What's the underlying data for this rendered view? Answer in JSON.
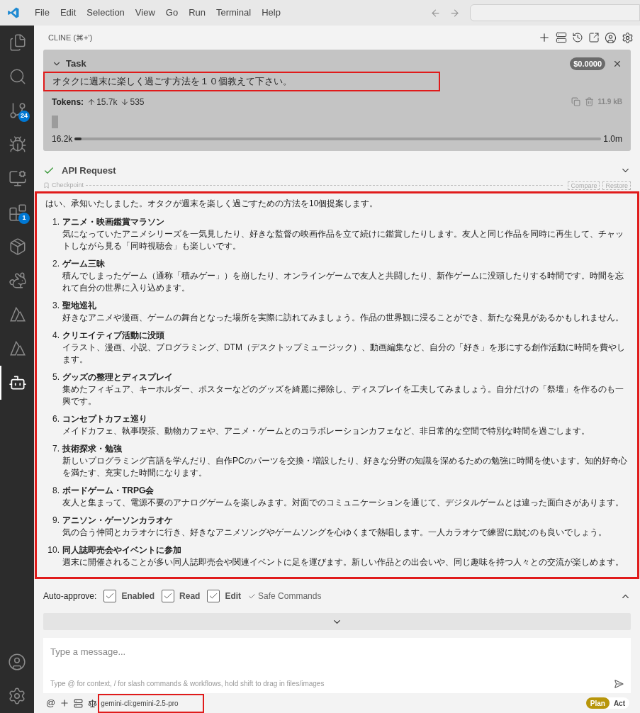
{
  "menu": [
    "File",
    "Edit",
    "Selection",
    "View",
    "Go",
    "Run",
    "Terminal",
    "Help"
  ],
  "activity_bar": [
    {
      "kind": "files",
      "selected": false
    },
    {
      "kind": "search",
      "selected": false
    },
    {
      "kind": "branch",
      "selected": false,
      "badge": "24"
    },
    {
      "kind": "debug",
      "selected": false
    },
    {
      "kind": "remote",
      "selected": false
    },
    {
      "kind": "blocks",
      "selected": false,
      "badge": "1"
    },
    {
      "kind": "package",
      "selected": false
    },
    {
      "kind": "animal",
      "selected": false
    },
    {
      "kind": "triangle",
      "selected": false
    },
    {
      "kind": "triangle",
      "selected": false
    },
    {
      "kind": "bot",
      "selected": true
    }
  ],
  "panel": {
    "title": "CLINE (⌘+')"
  },
  "task": {
    "title": "Task",
    "expanded": true,
    "cost": "$0.0000",
    "text": "オタクに週末に楽しく過ごす方法を１０個教えて下さい。",
    "highlighted": true,
    "tokens_label": "Tokens:",
    "tokens_in": "15.7k",
    "tokens_out": "535",
    "size": "11.9 kB",
    "context_used": "16.2k",
    "context_max": "1.0m",
    "level": 0.013
  },
  "api_request": {
    "title": "API Request",
    "done": true
  },
  "checkpoint": {
    "label": "Checkpoint",
    "buttons": [
      "Compare",
      "Restore"
    ]
  },
  "message": {
    "highlighted": true,
    "intro": "はい、承知いたしました。オタクが週末を楽しく過ごすための方法を10個提案します。",
    "items": [
      {
        "number": "1.",
        "title": "アニメ・映画鑑賞マラソン",
        "body": "気になっていたアニメシリーズを一気見したり、好きな監督の映画作品を立て続けに鑑賞したりします。友人と同じ作品を同時に再生して、チャットしながら見る「同時視聴会」も楽しいです。"
      },
      {
        "number": "2.",
        "title": "ゲーム三昧",
        "body": "積んでしまったゲーム（通称「積みゲー」）を崩したり、オンラインゲームで友人と共闘したり、新作ゲームに没頭したりする時間です。時間を忘れて自分の世界に入り込めます。"
      },
      {
        "number": "3.",
        "title": "聖地巡礼",
        "body": "好きなアニメや漫画、ゲームの舞台となった場所を実際に訪れてみましょう。作品の世界観に浸ることができ、新たな発見があるかもしれません。"
      },
      {
        "number": "4.",
        "title": "クリエイティブ活動に没頭",
        "body": "イラスト、漫画、小説、プログラミング、DTM（デスクトップミュージック）、動画編集など、自分の「好き」を形にする創作活動に時間を費やします。"
      },
      {
        "number": "5.",
        "title": "グッズの整理とディスプレイ",
        "body": "集めたフィギュア、キーホルダー、ポスターなどのグッズを綺麗に掃除し、ディスプレイを工夫してみましょう。自分だけの「祭壇」を作るのも一興です。"
      },
      {
        "number": "6.",
        "title": "コンセプトカフェ巡り",
        "body": "メイドカフェ、執事喫茶、動物カフェや、アニメ・ゲームとのコラボレーションカフェなど、非日常的な空間で特別な時間を過ごします。"
      },
      {
        "number": "7.",
        "title": "技術探求・勉強",
        "body": "新しいプログラミング言語を学んだり、自作PCのパーツを交換・増設したり、好きな分野の知識を深めるための勉強に時間を使います。知的好奇心を満たす、充実した時間になります。"
      },
      {
        "number": "8.",
        "title": "ボードゲーム・TRPG会",
        "body": "友人と集まって、電源不要のアナログゲームを楽しみます。対面でのコミュニケーションを通じて、デジタルゲームとは違った面白さがあります。"
      },
      {
        "number": "9.",
        "title": "アニソン・ゲーソンカラオケ",
        "body": "気の合う仲間とカラオケに行き、好きなアニメソングやゲームソングを心ゆくまで熱唱します。一人カラオケで練習に励むのも良いでしょう。"
      },
      {
        "number": "10.",
        "title": "同人誌即売会やイベントに参加",
        "body": "週末に開催されることが多い同人誌即売会や関連イベントに足を運びます。新しい作品との出会いや、同じ趣味を持つ人々との交流が楽しめます。"
      }
    ]
  },
  "auto_approve": {
    "label": "Auto-approve:",
    "expanded": false,
    "options": [
      {
        "kind": "box",
        "label": "Enabled",
        "checked": true
      },
      {
        "kind": "box",
        "label": "Read",
        "checked": true
      },
      {
        "kind": "box",
        "label": "Edit",
        "checked": true
      },
      {
        "kind": "tick",
        "label": "Safe Commands",
        "checked": true
      }
    ]
  },
  "input": {
    "placeholder": "Type a message...",
    "hint": "Type @ for context, / for slash commands & workflows, hold shift to drag in files/images"
  },
  "footer": {
    "at": "@",
    "model": "gemini-cli:gemini-2.5-pro",
    "model_highlighted": true,
    "modes": [
      {
        "label": "Plan",
        "selected": true
      },
      {
        "label": "Act",
        "selected": false
      }
    ]
  }
}
